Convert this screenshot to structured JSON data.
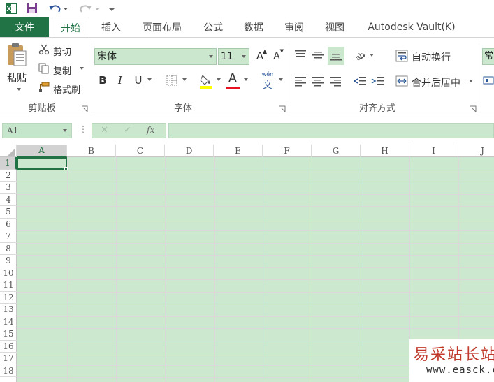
{
  "quick_access": {
    "icons": [
      "excel-logo-icon",
      "save-icon",
      "undo-icon",
      "redo-icon",
      "customize-icon"
    ],
    "colors": {
      "excel_green": "#217346",
      "save_purple": "#7a3e8f"
    }
  },
  "tabs": {
    "file": "文件",
    "items": [
      "开始",
      "插入",
      "页面布局",
      "公式",
      "数据",
      "审阅",
      "视图",
      "Autodesk Vault(K)"
    ],
    "active": "开始"
  },
  "ribbon": {
    "clipboard": {
      "paste": "粘贴",
      "cut": "剪切",
      "copy": "复制",
      "format_painter": "格式刷",
      "group_label": "剪贴板"
    },
    "font": {
      "font_name": "宋体",
      "font_size": "11",
      "grow_label": "A",
      "shrink_label": "A",
      "bold": "B",
      "italic": "I",
      "underline": "U",
      "font_color_label": "A",
      "phonetic_top": "wén",
      "phonetic_bottom": "文",
      "group_label": "字体",
      "highlight_color": "#ffff00",
      "font_color": "#e81123"
    },
    "alignment": {
      "wrap_text": "自动换行",
      "merge_center": "合并后居中",
      "group_label": "对齐方式"
    },
    "number": {
      "format_partial": "常"
    }
  },
  "formula_bar": {
    "name_box": "A1",
    "fx": "fx",
    "cancel": "✕",
    "enter": "✓",
    "dots": "⋮",
    "content": ""
  },
  "grid": {
    "columns": [
      "A",
      "B",
      "C",
      "D",
      "E",
      "F",
      "G",
      "H",
      "I",
      "J"
    ],
    "rows": [
      "1",
      "2",
      "3",
      "4",
      "5",
      "6",
      "7",
      "8",
      "9",
      "10",
      "11",
      "12",
      "13",
      "14",
      "15",
      "16",
      "17",
      "18"
    ],
    "active_cell": "A1",
    "cell_fill": "#cce8cf"
  },
  "watermark": {
    "title": "易采站长站",
    "url": "www.easck.com"
  }
}
